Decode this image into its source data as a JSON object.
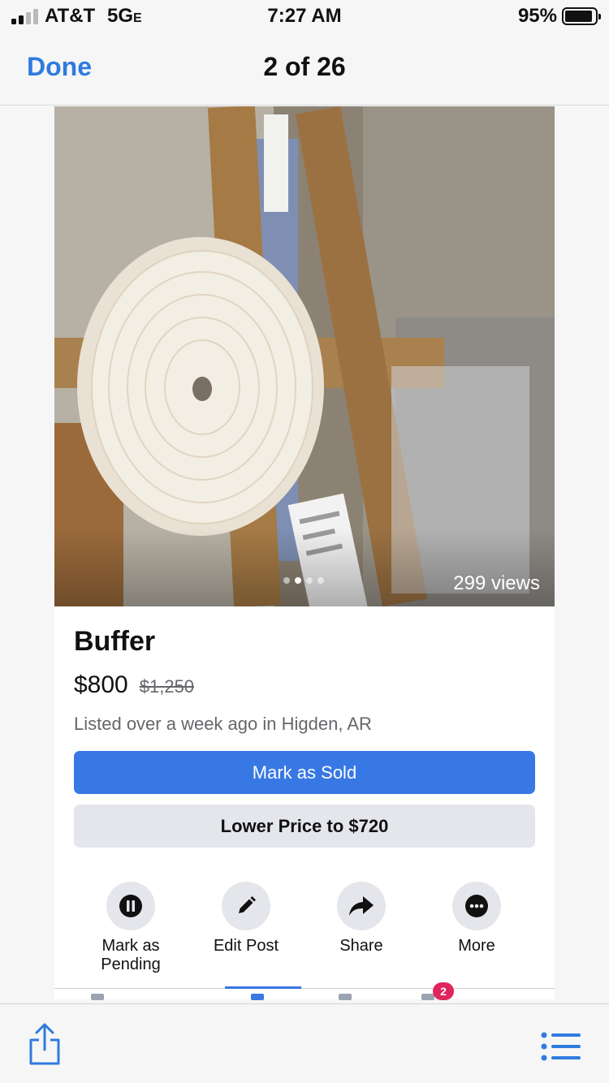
{
  "status_bar": {
    "carrier": "AT&T",
    "network": "5G",
    "network_suffix": "E",
    "time": "7:27 AM",
    "battery": "95%"
  },
  "nav": {
    "done_label": "Done",
    "title": "2 of 26"
  },
  "photo": {
    "views": "299 views",
    "page_count": 4,
    "active_page": 2
  },
  "listing": {
    "title": "Buffer",
    "price": "$800",
    "original_price": "$1,250",
    "meta": "Listed over a week ago in Higden, AR"
  },
  "buttons": {
    "mark_sold": "Mark as Sold",
    "lower_price": "Lower Price to $720"
  },
  "actions": [
    {
      "line1": "Mark as",
      "line2": "Pending",
      "icon": "pause-icon"
    },
    {
      "line1": "Edit Post",
      "line2": "",
      "icon": "pencil-icon"
    },
    {
      "line1": "Share",
      "line2": "",
      "icon": "share-arrow-icon"
    },
    {
      "line1": "More",
      "line2": "",
      "icon": "more-dots-icon"
    }
  ],
  "tab_badge": "2",
  "colors": {
    "accent": "#3878e4",
    "link": "#2f7bdf",
    "secondary_button": "#e4e6eb",
    "muted_text": "#65676b"
  }
}
